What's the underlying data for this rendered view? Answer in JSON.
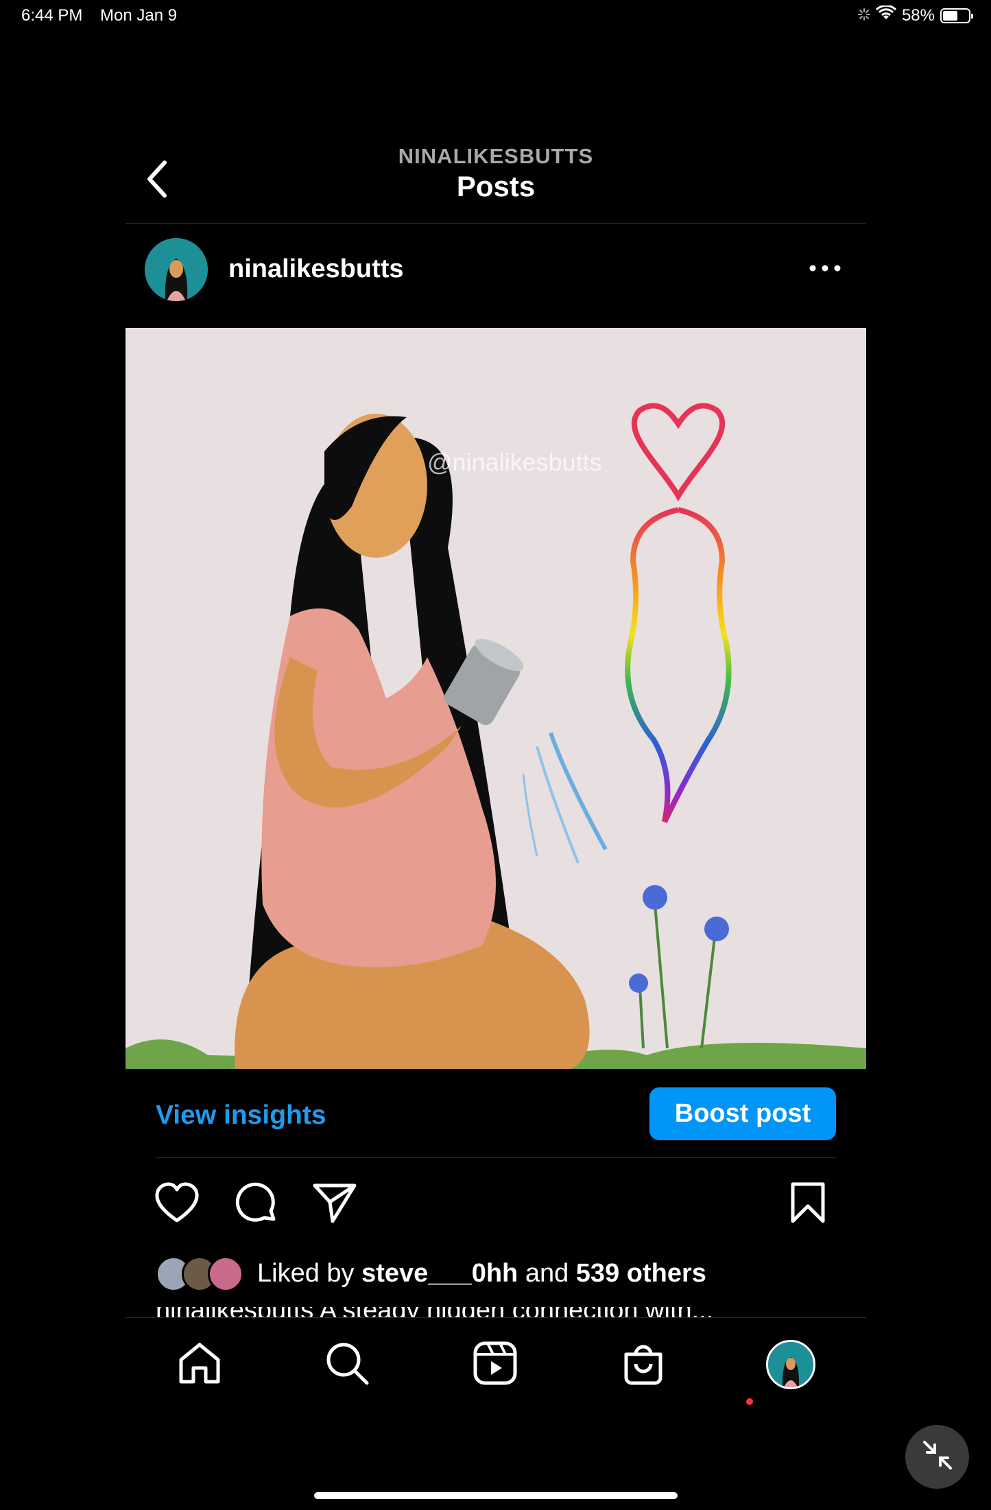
{
  "status_bar": {
    "time": "6:44 PM",
    "date": "Mon Jan 9",
    "battery": "58%",
    "battery_level": 0.58
  },
  "header": {
    "username": "NINALIKESBUTTS",
    "title": "Posts"
  },
  "post": {
    "username": "ninalikesbutts",
    "watermark": "@ninalikesbutts",
    "insights_label": "View insights",
    "boost_label": "Boost post",
    "likes": {
      "prefix": "Liked by ",
      "user": "steve___0hh",
      "middle": " and ",
      "others": "539 others"
    },
    "caption_peek": "ninalikesbutts A steady hidden connection with..."
  },
  "icons": {
    "back": "chevron-left-icon",
    "more": "more-horizontal-icon",
    "like": "heart-icon",
    "comment": "comment-icon",
    "share": "paper-plane-icon",
    "save": "bookmark-icon",
    "home": "home-icon",
    "search": "search-icon",
    "reels": "reels-icon",
    "shop": "shop-bag-icon",
    "pip": "minimize-arrows-icon"
  },
  "colors": {
    "accent": "#0095f6",
    "link": "#1e9bf0",
    "notification": "#ff3040"
  }
}
